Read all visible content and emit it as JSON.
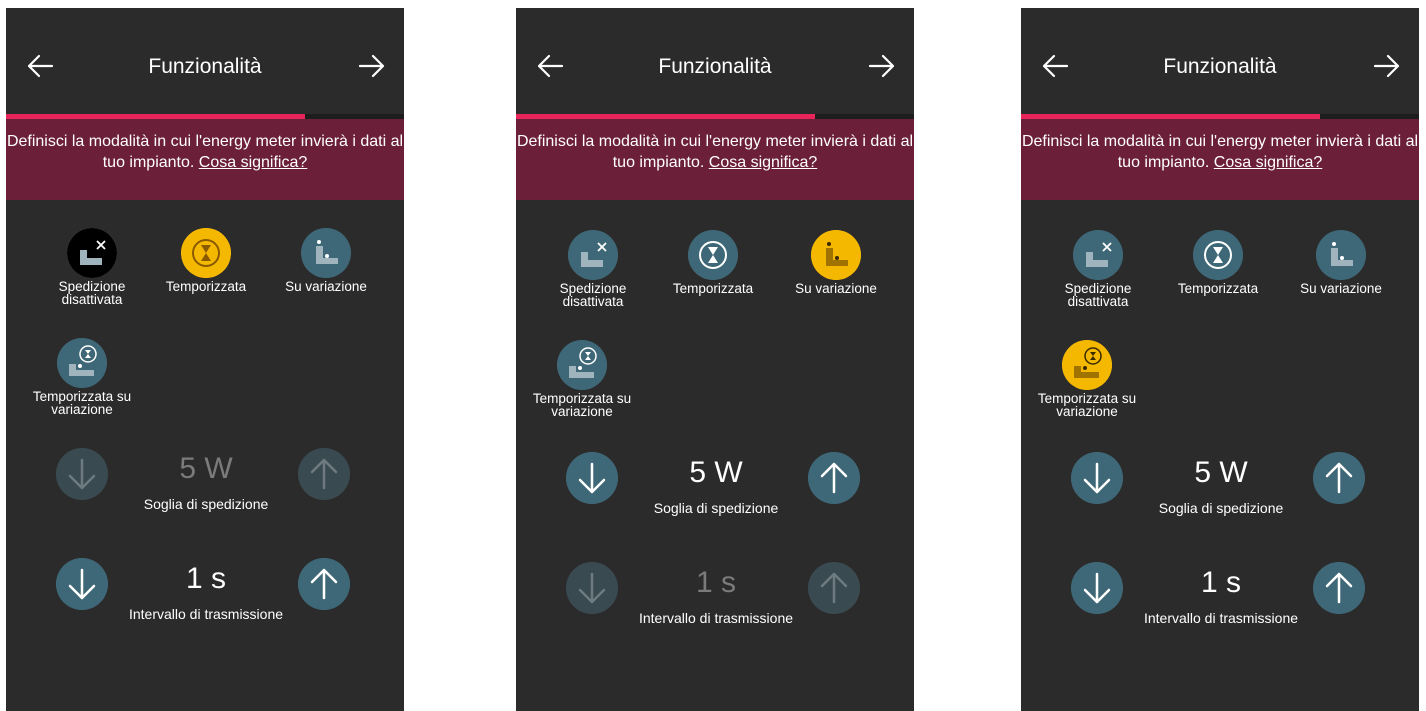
{
  "screens": [
    {
      "title": "Funzionalità",
      "progress": 0.75,
      "banner_text": "Definisci la modalità in cui l'energy meter invierà  i dati al tuo impianto.",
      "banner_link": "Cosa significa?",
      "selected_mode": "Temporizzata",
      "modes": [
        {
          "label": "Spedizione\ndisattivata",
          "icon": "meter-off-icon"
        },
        {
          "label": "Temporizzata",
          "icon": "hourglass-icon"
        },
        {
          "label": "Su variazione",
          "icon": "variation-icon"
        },
        {
          "label": "Temporizzata su\nvariazione",
          "icon": "variation-hourglass-icon"
        }
      ],
      "threshold": {
        "value": "5 W",
        "label": "Soglia di spedizione",
        "enabled": false
      },
      "interval": {
        "value": "1 s",
        "label": "Intervallo di trasmissione",
        "enabled": true
      }
    },
    {
      "title": "Funzionalità",
      "progress": 0.75,
      "banner_text": "Definisci la modalità in cui l'energy meter invierà  i dati al tuo impianto.",
      "banner_link": "Cosa significa?",
      "selected_mode": "Su variazione",
      "modes": [
        {
          "label": "Spedizione\ndisattivata",
          "icon": "meter-off-icon"
        },
        {
          "label": "Temporizzata",
          "icon": "hourglass-icon"
        },
        {
          "label": "Su variazione",
          "icon": "variation-icon"
        },
        {
          "label": "Temporizzata su\nvariazione",
          "icon": "variation-hourglass-icon"
        }
      ],
      "threshold": {
        "value": "5 W",
        "label": "Soglia di spedizione",
        "enabled": true
      },
      "interval": {
        "value": "1 s",
        "label": "Intervallo di trasmissione",
        "enabled": false
      }
    },
    {
      "title": "Funzionalità",
      "progress": 0.75,
      "banner_text": "Definisci la modalità in cui l'energy meter invierà  i dati al tuo impianto.",
      "banner_link": "Cosa significa?",
      "selected_mode": "Temporizzata su variazione",
      "modes": [
        {
          "label": "Spedizione\ndisattivata",
          "icon": "meter-off-icon"
        },
        {
          "label": "Temporizzata",
          "icon": "hourglass-icon"
        },
        {
          "label": "Su variazione",
          "icon": "variation-icon"
        },
        {
          "label": "Temporizzata su\nvariazione",
          "icon": "variation-hourglass-icon"
        }
      ],
      "threshold": {
        "value": "5 W",
        "label": "Soglia di spedizione",
        "enabled": true
      },
      "interval": {
        "value": "1 s",
        "label": "Intervallo di trasmissione",
        "enabled": true
      }
    }
  ],
  "colors": {
    "background": "#2c2b2b",
    "accent_progress": "#e8245a",
    "banner": "#6b1f39",
    "icon_circle": "#3e6877",
    "icon_selected": "#f5b800"
  }
}
